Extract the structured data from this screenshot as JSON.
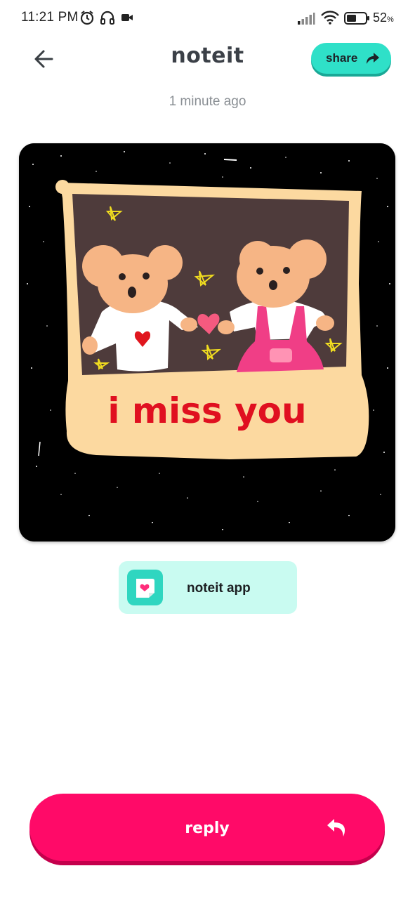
{
  "status_bar": {
    "time": "11:21 PM",
    "battery_percent": "52",
    "battery_percent_sign": "%",
    "battery_level": 0.52,
    "icons": [
      "alarm-icon",
      "headphones-icon",
      "video-camera-icon",
      "signal-icon",
      "wifi-icon",
      "battery-icon"
    ]
  },
  "header": {
    "title": "noteit",
    "share_label": "share",
    "back_icon": "arrow-left-icon",
    "share_icon": "share-arrow-icon"
  },
  "note": {
    "timestamp": "1 minute ago",
    "drawing_text": "i miss you"
  },
  "app_badge": {
    "label": "noteit app",
    "icon": "heart-note-icon"
  },
  "reply": {
    "label": "reply",
    "icon": "reply-arrow-icon"
  },
  "colors": {
    "accent_teal": "#2fe0c8",
    "badge_bg": "#c9fbf1",
    "reply_pink": "#ff0a68",
    "drawing_text_red": "#e01020",
    "frame_cream": "#fcd9a0",
    "bear_skin": "#f6b585"
  }
}
